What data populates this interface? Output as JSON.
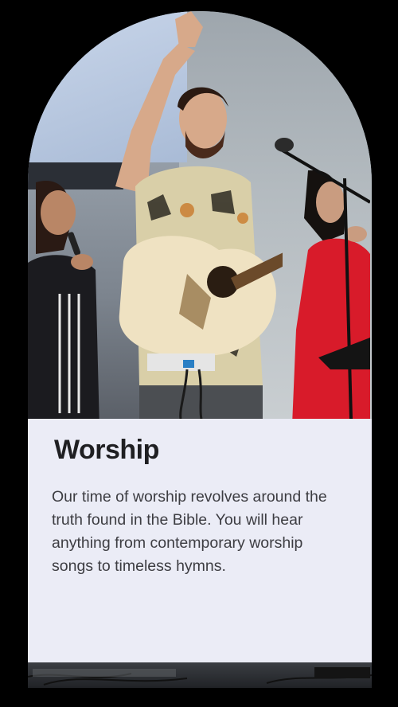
{
  "card": {
    "image_alt": "Worship team performing on stage",
    "title": "Worship",
    "body": "Our time of worship revolves around the truth found in the Bible. You will hear anything from contemporary worship songs to timeless hymns."
  },
  "colors": {
    "background": "#000000",
    "panel": "#ebecf6",
    "title": "#1f1f22",
    "body": "#3d3d42",
    "dress_red": "#d81b2a"
  }
}
